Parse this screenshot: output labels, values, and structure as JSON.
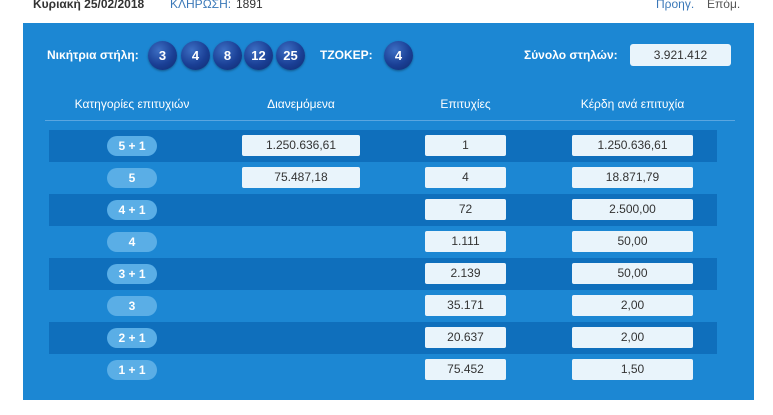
{
  "topbar": {
    "date": "Κυριακή 25/02/2018",
    "draw_label": "ΚΛΗΡΩΣΗ:",
    "draw_number": "1891",
    "prev": "Προηγ.",
    "next": "Επόμ."
  },
  "results": {
    "winning_label": "Νικήτρια στήλη:",
    "numbers": [
      "3",
      "4",
      "8",
      "12",
      "25"
    ],
    "joker_label": "ΤΖΟΚΕΡ:",
    "joker": "4",
    "total_label": "Σύνολο στηλών:",
    "total": "3.921.412"
  },
  "table": {
    "headers": [
      "Κατηγορίες επιτυχιών",
      "Διανεμόμενα",
      "Επιτυχίες",
      "Κέρδη ανά επιτυχία"
    ],
    "rows": [
      {
        "category": "5 + 1",
        "distributed": "1.250.636,61",
        "winners": "1",
        "prize": "1.250.636,61"
      },
      {
        "category": "5",
        "distributed": "75.487,18",
        "winners": "4",
        "prize": "18.871,79"
      },
      {
        "category": "4 + 1",
        "distributed": "",
        "winners": "72",
        "prize": "2.500,00"
      },
      {
        "category": "4",
        "distributed": "",
        "winners": "1.111",
        "prize": "50,00"
      },
      {
        "category": "3 + 1",
        "distributed": "",
        "winners": "2.139",
        "prize": "50,00"
      },
      {
        "category": "3",
        "distributed": "",
        "winners": "35.171",
        "prize": "2,00"
      },
      {
        "category": "2 + 1",
        "distributed": "",
        "winners": "20.637",
        "prize": "2,00"
      },
      {
        "category": "1 + 1",
        "distributed": "",
        "winners": "75.452",
        "prize": "1,50"
      }
    ]
  }
}
